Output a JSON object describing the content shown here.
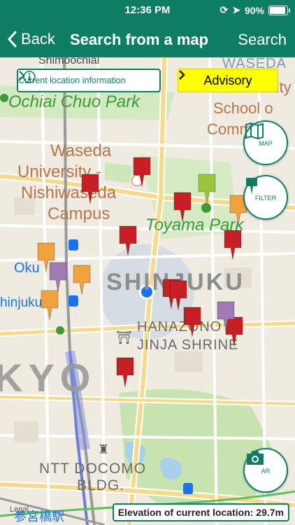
{
  "status_bar": {
    "time": "12:36 PM",
    "battery": "90%",
    "battery_level": 0.9
  },
  "nav": {
    "back_label": "Back",
    "title": "Search from a map",
    "search_label": "Search"
  },
  "overlay": {
    "current_location_info": "Current location information",
    "advisory": "Advisory",
    "map_button": "MAP",
    "filter_button": "FILTER",
    "ar_button": "AR",
    "elevation": "Elevation of current location: 29.7m"
  },
  "map_labels": {
    "shimoochiai": "Shimoochiai",
    "waseda_top": "WASEDA",
    "university_top": "University",
    "school_of": "School o",
    "commerce": "Comm ere",
    "ochiai_park": "Ochiai Chuo Park",
    "waseda_campus_1": "Waseda",
    "waseda_campus_2": "University -",
    "waseda_campus_3": "Nishiwaseda",
    "waseda_campus_4": "Campus",
    "toyama_park": "Toyama Park",
    "okubo": "Oku",
    "shinjuku_station": "hinjuku",
    "shinjuku_district": "SHINJUKU",
    "hanazono_1": "HANAZONO",
    "hanazono_2": "JINJA SHRINE",
    "tokyo": "KYO",
    "ntt_1": "NTT DOCOMO",
    "ntt_2": "BLDG.",
    "sangubashi": "参宮橋駅",
    "legal": "Legal"
  },
  "colors": {
    "nav_green": "#0f7d63",
    "pin_red": "#c81f26",
    "pin_orange": "#f0a33c",
    "pin_purple": "#a07ab5",
    "pin_lime": "#9dc53a",
    "park_green": "#c7e3b0",
    "label_brown": "#b7764b",
    "label_green": "#3c9a3c",
    "location_blue": "#1a73e8"
  }
}
